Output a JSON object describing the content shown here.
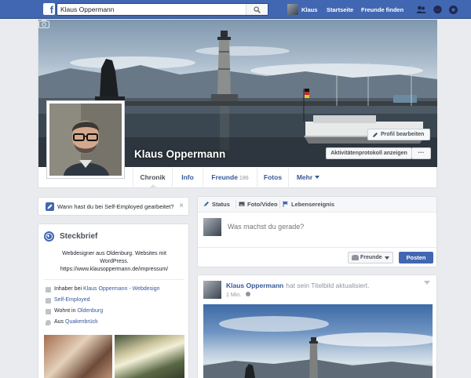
{
  "topbar": {
    "logo": "f",
    "search_value": "Klaus Oppermann",
    "user_name": "Klaus",
    "home": "Startseite",
    "find_friends": "Freunde finden"
  },
  "profile": {
    "name": "Klaus Oppermann",
    "edit_profile": "Profil bearbeiten",
    "activity_log": "Aktivitätenprotokoll anzeigen",
    "more_dots": "···",
    "tabs": {
      "timeline": "Chronik",
      "about": "Info",
      "friends": "Freunde",
      "friends_count": "186",
      "photos": "Fotos",
      "more": "Mehr"
    }
  },
  "prompt": {
    "text": "Wann hast du bei Self-Employed gearbeitet?",
    "close": "×"
  },
  "about": {
    "title": "Steckbrief",
    "bio_line1": "Webdesigner aus Oldenburg. Websites mit",
    "bio_line2": "WordPress.",
    "bio_line3": "https://www.klausoppermann.de/impressum/",
    "rows": [
      {
        "prefix": "Inhaber bei ",
        "link": "Klaus Oppermann - Webdesign",
        "icon": "briefcase-icon"
      },
      {
        "prefix": "",
        "link": "Self-Employed",
        "icon": "briefcase-icon"
      },
      {
        "prefix": "Wohnt in ",
        "link": "Oldenburg",
        "icon": "home-icon"
      },
      {
        "prefix": "Aus ",
        "link": "Quakenbrück",
        "icon": "location-pin-icon"
      }
    ]
  },
  "composer": {
    "tab_status": "Status",
    "tab_photo": "Foto/Video",
    "tab_life_event": "Lebensereignis",
    "placeholder": "Was machst du gerade?",
    "audience": "Freunde",
    "post": "Posten"
  },
  "post": {
    "author": "Klaus Oppermann",
    "action": "hat sein Titelbild aktualisiert.",
    "time": "1 Min."
  },
  "colors": {
    "brand": "#4267b2",
    "link": "#365899",
    "background": "#e9ebee"
  }
}
